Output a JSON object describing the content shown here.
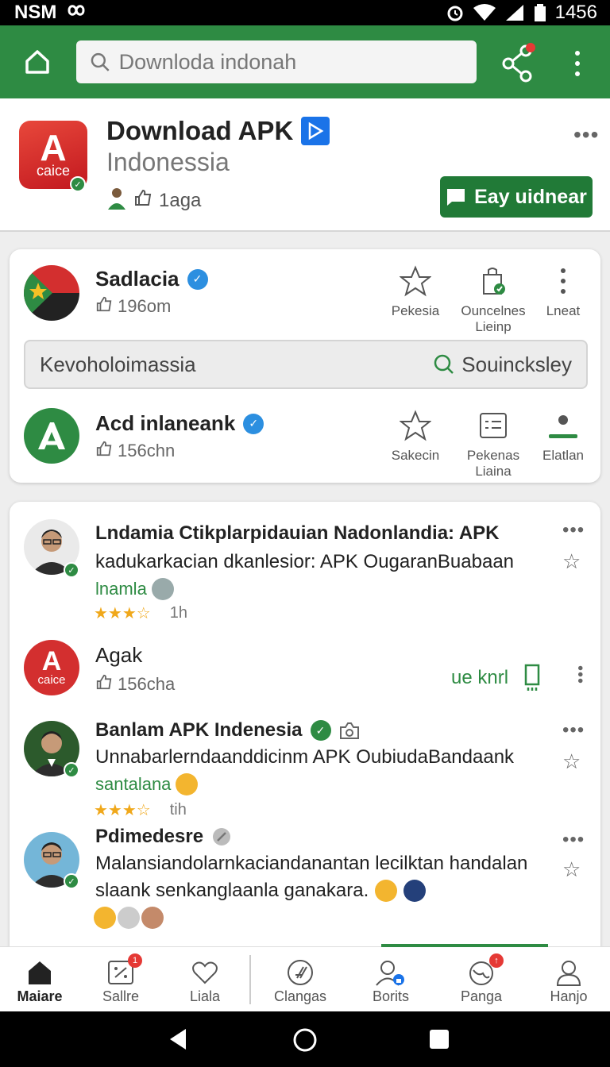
{
  "status_bar": {
    "carrier": "NSM",
    "time": "1456"
  },
  "search": {
    "placeholder": "Downloda indonah"
  },
  "app": {
    "logo_letter": "A",
    "logo_text": "caice",
    "title": "Download APK",
    "subtitle": "Indonessia",
    "likes": "1aga",
    "cta_label": "Eay uidnear"
  },
  "card1": {
    "rows": [
      {
        "name": "Sadlacia",
        "count": "196om",
        "actions": [
          {
            "label": "Pekesia"
          },
          {
            "label": "Ouncelnes Lieinp"
          },
          {
            "label": "Lneat"
          }
        ]
      },
      {
        "name": "Acd inlaneank",
        "count": "156chn",
        "actions": [
          {
            "label": "Sakecin"
          },
          {
            "label": "Pekenas Liaina"
          },
          {
            "label": "Elatlan"
          }
        ]
      }
    ],
    "search_value": "Kevoholoimassia",
    "search_button": "Souincksley"
  },
  "feed": [
    {
      "title": "Lndamia Ctikplarpidauian Nadonlandia: APK",
      "text": "kadukarkacian dkanlesior: APK OugaranBuabaan",
      "tag": "lnamla",
      "stars": "★★★☆",
      "time": "1h"
    },
    {
      "name": "Agak",
      "count": "156cha",
      "action": "ue knrl",
      "logo_letter": "A",
      "logo_text": "caice"
    },
    {
      "title": "Banlam APK Indenesia",
      "text": "Unnabarlerndaanddicinm APK OubiudaBandaank",
      "tag": "santalana",
      "stars": "★★★☆",
      "time": "tih"
    },
    {
      "title": "Pdimedesre",
      "text_line1": "Malansiandolarnkaciandanantan lecilktan handalan",
      "text_line2": "slaank senkanglaanla ganakara."
    }
  ],
  "bottom_nav": [
    {
      "label": "Maiare"
    },
    {
      "label": "Sallre",
      "badge": "1"
    },
    {
      "label": "Liala"
    },
    {
      "label": "Clangas"
    },
    {
      "label": "Borits"
    },
    {
      "label": "Panga",
      "badge": "↑"
    },
    {
      "label": "Hanjo"
    }
  ],
  "colors": {
    "primary": "#2e8b43",
    "accent_blue": "#2c8fe0",
    "brand_red": "#d32f2f"
  }
}
